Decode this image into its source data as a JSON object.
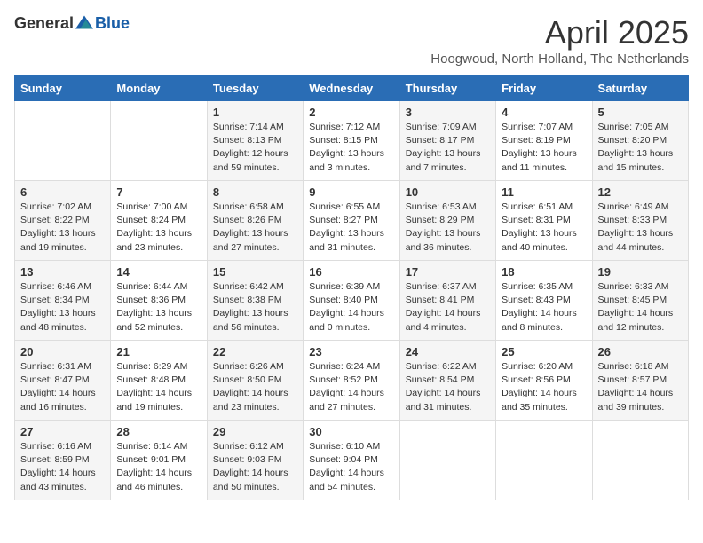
{
  "logo": {
    "text_general": "General",
    "text_blue": "Blue"
  },
  "title": "April 2025",
  "subtitle": "Hoogwoud, North Holland, The Netherlands",
  "days_of_week": [
    "Sunday",
    "Monday",
    "Tuesday",
    "Wednesday",
    "Thursday",
    "Friday",
    "Saturday"
  ],
  "weeks": [
    [
      null,
      null,
      {
        "day": "1",
        "sunrise": "Sunrise: 7:14 AM",
        "sunset": "Sunset: 8:13 PM",
        "daylight": "Daylight: 12 hours and 59 minutes."
      },
      {
        "day": "2",
        "sunrise": "Sunrise: 7:12 AM",
        "sunset": "Sunset: 8:15 PM",
        "daylight": "Daylight: 13 hours and 3 minutes."
      },
      {
        "day": "3",
        "sunrise": "Sunrise: 7:09 AM",
        "sunset": "Sunset: 8:17 PM",
        "daylight": "Daylight: 13 hours and 7 minutes."
      },
      {
        "day": "4",
        "sunrise": "Sunrise: 7:07 AM",
        "sunset": "Sunset: 8:19 PM",
        "daylight": "Daylight: 13 hours and 11 minutes."
      },
      {
        "day": "5",
        "sunrise": "Sunrise: 7:05 AM",
        "sunset": "Sunset: 8:20 PM",
        "daylight": "Daylight: 13 hours and 15 minutes."
      }
    ],
    [
      {
        "day": "6",
        "sunrise": "Sunrise: 7:02 AM",
        "sunset": "Sunset: 8:22 PM",
        "daylight": "Daylight: 13 hours and 19 minutes."
      },
      {
        "day": "7",
        "sunrise": "Sunrise: 7:00 AM",
        "sunset": "Sunset: 8:24 PM",
        "daylight": "Daylight: 13 hours and 23 minutes."
      },
      {
        "day": "8",
        "sunrise": "Sunrise: 6:58 AM",
        "sunset": "Sunset: 8:26 PM",
        "daylight": "Daylight: 13 hours and 27 minutes."
      },
      {
        "day": "9",
        "sunrise": "Sunrise: 6:55 AM",
        "sunset": "Sunset: 8:27 PM",
        "daylight": "Daylight: 13 hours and 31 minutes."
      },
      {
        "day": "10",
        "sunrise": "Sunrise: 6:53 AM",
        "sunset": "Sunset: 8:29 PM",
        "daylight": "Daylight: 13 hours and 36 minutes."
      },
      {
        "day": "11",
        "sunrise": "Sunrise: 6:51 AM",
        "sunset": "Sunset: 8:31 PM",
        "daylight": "Daylight: 13 hours and 40 minutes."
      },
      {
        "day": "12",
        "sunrise": "Sunrise: 6:49 AM",
        "sunset": "Sunset: 8:33 PM",
        "daylight": "Daylight: 13 hours and 44 minutes."
      }
    ],
    [
      {
        "day": "13",
        "sunrise": "Sunrise: 6:46 AM",
        "sunset": "Sunset: 8:34 PM",
        "daylight": "Daylight: 13 hours and 48 minutes."
      },
      {
        "day": "14",
        "sunrise": "Sunrise: 6:44 AM",
        "sunset": "Sunset: 8:36 PM",
        "daylight": "Daylight: 13 hours and 52 minutes."
      },
      {
        "day": "15",
        "sunrise": "Sunrise: 6:42 AM",
        "sunset": "Sunset: 8:38 PM",
        "daylight": "Daylight: 13 hours and 56 minutes."
      },
      {
        "day": "16",
        "sunrise": "Sunrise: 6:39 AM",
        "sunset": "Sunset: 8:40 PM",
        "daylight": "Daylight: 14 hours and 0 minutes."
      },
      {
        "day": "17",
        "sunrise": "Sunrise: 6:37 AM",
        "sunset": "Sunset: 8:41 PM",
        "daylight": "Daylight: 14 hours and 4 minutes."
      },
      {
        "day": "18",
        "sunrise": "Sunrise: 6:35 AM",
        "sunset": "Sunset: 8:43 PM",
        "daylight": "Daylight: 14 hours and 8 minutes."
      },
      {
        "day": "19",
        "sunrise": "Sunrise: 6:33 AM",
        "sunset": "Sunset: 8:45 PM",
        "daylight": "Daylight: 14 hours and 12 minutes."
      }
    ],
    [
      {
        "day": "20",
        "sunrise": "Sunrise: 6:31 AM",
        "sunset": "Sunset: 8:47 PM",
        "daylight": "Daylight: 14 hours and 16 minutes."
      },
      {
        "day": "21",
        "sunrise": "Sunrise: 6:29 AM",
        "sunset": "Sunset: 8:48 PM",
        "daylight": "Daylight: 14 hours and 19 minutes."
      },
      {
        "day": "22",
        "sunrise": "Sunrise: 6:26 AM",
        "sunset": "Sunset: 8:50 PM",
        "daylight": "Daylight: 14 hours and 23 minutes."
      },
      {
        "day": "23",
        "sunrise": "Sunrise: 6:24 AM",
        "sunset": "Sunset: 8:52 PM",
        "daylight": "Daylight: 14 hours and 27 minutes."
      },
      {
        "day": "24",
        "sunrise": "Sunrise: 6:22 AM",
        "sunset": "Sunset: 8:54 PM",
        "daylight": "Daylight: 14 hours and 31 minutes."
      },
      {
        "day": "25",
        "sunrise": "Sunrise: 6:20 AM",
        "sunset": "Sunset: 8:56 PM",
        "daylight": "Daylight: 14 hours and 35 minutes."
      },
      {
        "day": "26",
        "sunrise": "Sunrise: 6:18 AM",
        "sunset": "Sunset: 8:57 PM",
        "daylight": "Daylight: 14 hours and 39 minutes."
      }
    ],
    [
      {
        "day": "27",
        "sunrise": "Sunrise: 6:16 AM",
        "sunset": "Sunset: 8:59 PM",
        "daylight": "Daylight: 14 hours and 43 minutes."
      },
      {
        "day": "28",
        "sunrise": "Sunrise: 6:14 AM",
        "sunset": "Sunset: 9:01 PM",
        "daylight": "Daylight: 14 hours and 46 minutes."
      },
      {
        "day": "29",
        "sunrise": "Sunrise: 6:12 AM",
        "sunset": "Sunset: 9:03 PM",
        "daylight": "Daylight: 14 hours and 50 minutes."
      },
      {
        "day": "30",
        "sunrise": "Sunrise: 6:10 AM",
        "sunset": "Sunset: 9:04 PM",
        "daylight": "Daylight: 14 hours and 54 minutes."
      },
      null,
      null,
      null
    ]
  ]
}
